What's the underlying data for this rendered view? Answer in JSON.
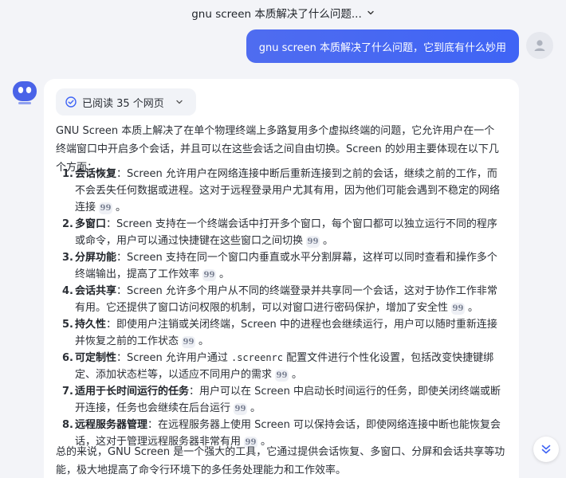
{
  "topbar": {
    "title": "gnu screen 本质解决了什么问题..."
  },
  "user_message": {
    "text": "gnu screen 本质解决了什么问题，它到底有什么妙用"
  },
  "answer": {
    "read_status": "已阅读 35 个网页",
    "intro": "GNU Screen 本质上解决了在单个物理终端上多路复用多个虚拟终端的问题，它允许用户在一个终端窗口中开启多个会话，并且可以在这些会话之间自由切换。Screen 的妙用主要体现在以下几个方面：",
    "points": [
      {
        "num": "1.",
        "title": "会话恢复",
        "text": "：Screen 允许用户在网络连接中断后重新连接到之前的会话，继续之前的工作，而不会丢失任何数据或进程。这对于远程登录用户尤其有用，因为他们可能会遇到不稳定的网络连接",
        "end": "。"
      },
      {
        "num": "2.",
        "title": "多窗口",
        "text": "：Screen 支持在一个终端会话中打开多个窗口，每个窗口都可以独立运行不同的程序或命令，用户可以通过快捷键在这些窗口之间切换",
        "end": "。"
      },
      {
        "num": "3.",
        "title": "分屏功能",
        "text": "：Screen 支持在同一个窗口内垂直或水平分割屏幕，这样可以同时查看和操作多个终端输出，提高了工作效率",
        "end": "。"
      },
      {
        "num": "4.",
        "title": "会话共享",
        "text": "：Screen 允许多个用户从不同的终端登录并共享同一个会话，这对于协作工作非常有用。它还提供了窗口访问权限的机制，可以对窗口进行密码保护，增加了安全性",
        "end": "。"
      },
      {
        "num": "5.",
        "title": "持久性",
        "text": "：即使用户注销或关闭终端，Screen 中的进程也会继续运行，用户可以随时重新连接并恢复之前的工作状态",
        "end": "。"
      },
      {
        "num": "6.",
        "title": "可定制性",
        "text_a": "：Screen 允许用户通过 ",
        "code": ".screenrc",
        "text_b": " 配置文件进行个性化设置，包括改变快捷键绑定、添加状态栏等，以适应不同用户的需求",
        "end": "。"
      },
      {
        "num": "7.",
        "title": "适用于长时间运行的任务",
        "text": "：用户可以在 Screen 中启动长时间运行的任务，即使关闭终端或断开连接，任务也会继续在后台运行",
        "end": "。"
      },
      {
        "num": "8.",
        "title": "远程服务器管理",
        "text": "：在远程服务器上使用 Screen 可以保持会话，即使网络连接中断也能恢复会话，这对于管理远程服务器非常有用",
        "end": "。"
      }
    ],
    "cite_glyph": "99",
    "outro": "总的来说，GNU Screen 是一个强大的工具，它通过提供会话恢复、多窗口、分屏和会话共享等功能，极大地提高了命令行环境下的多任务处理能力和工作效率。"
  },
  "colors": {
    "accent": "#3f64f5",
    "bot": "#4a63e8",
    "background": "#f3f4f8"
  },
  "icons": {
    "topbar_chevron": "chevron-down-icon",
    "read_check": "check-circle-icon",
    "scroll": "double-chevron-down-icon",
    "bot": "robot-avatar-icon",
    "user": "user-avatar-icon"
  }
}
